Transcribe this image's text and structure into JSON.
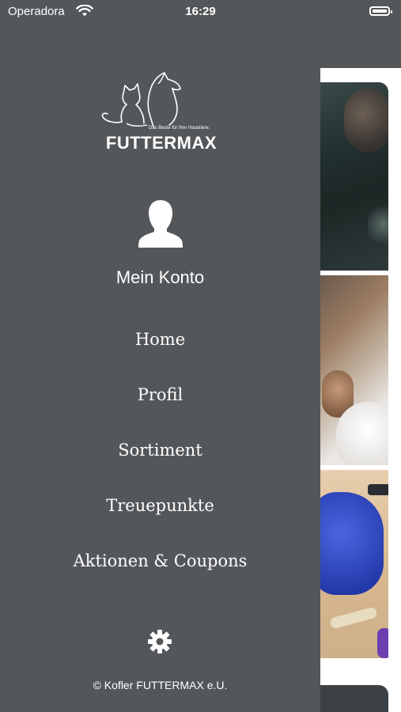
{
  "status_bar": {
    "carrier": "Operadora",
    "time": "16:29"
  },
  "brand": {
    "name": "FUTTERMAX",
    "tagline": "Das Beste für Ihre Haustiere."
  },
  "account": {
    "label": "Mein Konto"
  },
  "menu": {
    "items": [
      {
        "label": "Home"
      },
      {
        "label": "Profil"
      },
      {
        "label": "Sortiment"
      },
      {
        "label": "Treuepunkte"
      },
      {
        "label": "Aktionen & Coupons"
      }
    ]
  },
  "footer": {
    "copyright": "© Kofler FUTTERMAX e.U."
  },
  "colors": {
    "drawer_bg": "#54575a",
    "text": "#ffffff"
  },
  "icons": [
    "wifi-icon",
    "battery-icon",
    "user-avatar-icon",
    "gear-icon"
  ]
}
